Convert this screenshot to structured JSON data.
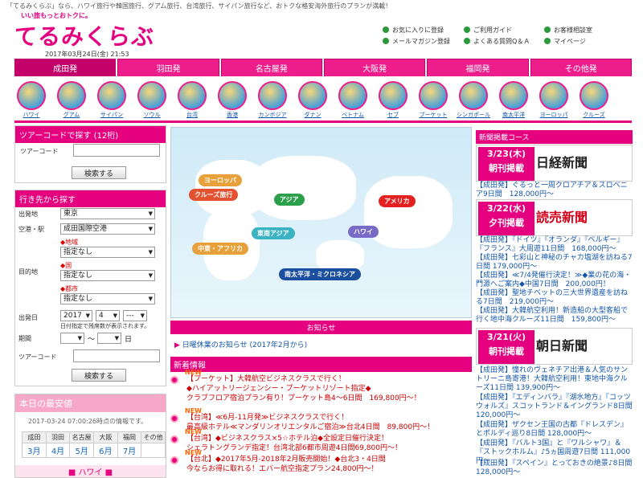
{
  "header": {
    "tagline": "「てるみくらぶ」なら、ハワイ旅行や韓国旅行、グアム旅行、台湾旅行、サイパン旅行など、おトクな格安海外旅行のプランが満載！",
    "logo_sub": "いい旅もっとおトクに。",
    "logo": "てるみくらぶ",
    "datetime": "2017年03月24日(金) 21:53",
    "links": [
      "お気に入りに登録",
      "ご利用ガイド",
      "お客様相談室",
      "メールマガジン登録",
      "よくある質問Q＆Ａ",
      "マイページ"
    ]
  },
  "nav": [
    "成田発",
    "羽田発",
    "名古屋発",
    "大阪発",
    "福岡発",
    "その他発"
  ],
  "destinations": [
    "ハワイ",
    "グアム",
    "サイパン",
    "ソウル",
    "台湾",
    "香港",
    "カンボジア",
    "ダナン",
    "ベトナム",
    "セブ",
    "プーケット",
    "シンガポール",
    "南太平洋",
    "ヨーロッパ",
    "クルーズ"
  ],
  "tourcode": {
    "head": "ツアーコードで探す (12桁)",
    "label": "ツアーコード",
    "button": "検索する"
  },
  "destsearch": {
    "head": "行き先から探す",
    "dep_label": "出発地",
    "dep_value": "東京",
    "airport_label": "空港・駅",
    "airport_value": "成田国際空港",
    "area_note": "◆地域",
    "area_value": "指定なし",
    "dest_label": "目的地",
    "country_note": "◆国",
    "country_value": "指定なし",
    "city_note": "◆都市",
    "city_value": "指定なし",
    "date_label": "出発日",
    "year": "2017",
    "month": "4",
    "day": "---",
    "date_note": "日付指定で残席数が表示されます。",
    "period_label": "期間",
    "period_sep": "〜",
    "period_unit": "日",
    "code_label": "ツアーコード",
    "button": "検索する"
  },
  "cheapest": {
    "head": "本日の最安値",
    "info": "2017-03-24 07:00:26時点の情報です。",
    "origins": [
      "成田",
      "羽田",
      "名古屋",
      "大阪",
      "福岡",
      "その他"
    ],
    "months": [
      "3月",
      "4月",
      "5月",
      "6月",
      "7月"
    ],
    "region": "■ ハワイ ■"
  },
  "map": {
    "labels": [
      "ヨーロッパ",
      "クルーズ旅行",
      "アジア",
      "アメリカ",
      "東南アジア",
      "ハワイ",
      "中東・アフリカ",
      "南太平洋・ミクロネシア"
    ]
  },
  "notice": {
    "head": "お知らせ",
    "item": "日曜休業のお知らせ (2017年2月から)"
  },
  "news": {
    "head": "新着情報",
    "badge": "NEW",
    "items": [
      [
        "【プーケット】大韓航空ビジネスクラスで行く！",
        "◆ハイアットリージェンシー・プーケットリゾート指定◆",
        "クラブフロア宿泊プラン有り！プーケット島4〜6日間　169,800円〜！"
      ],
      [
        "【台湾】≪6月-11月発≫ビジネスクラスで行く！",
        "最高級ホテル≪マンダリンオリエンタルご宿泊≫台北4日間　89,800円〜！"
      ],
      [
        "【台湾】◆ビジネスクラス×5☆ホテル泊◆全設定日催行決定！",
        "シェラトングランデ指定！台湾北部6都市周遊4日間69,800円〜！"
      ],
      [
        "【台北】◆2017年5月-2018年2月販売開始！◆台北3・4日間",
        "今ならお得に取れる！エバー航空指定プラン24,800円〜！"
      ]
    ]
  },
  "right": {
    "head": "新聞掲載コース",
    "papers": [
      {
        "date": "3/23(木)",
        "kind": "朝刊掲載",
        "name": "日経新聞",
        "color": "#1a7a2a"
      },
      {
        "date": "3/22(水)",
        "kind": "夕刊掲載",
        "name": "読売新聞",
        "color": "#d0001b"
      },
      {
        "date": "3/21(火)",
        "kind": "朝刊掲載",
        "name": "朝日新聞",
        "color": "#1a7a2a"
      }
    ],
    "texts": [
      "【成田発】ぐるっと一周クロアチア＆スロベニア9日間　128,000円〜",
      "【成田発】『ドイツ』『オランダ』『ベルギー』『フランス』大周遊11日間　168,000円〜",
      "【成田発】七彩山と神秘のチャカ塩湖を訪ねる7日間 179,000円〜",
      "【成田発】≪7/4発催行決定！≫◆業の花の海・門源へご案内◆中国7日間　200,000円！",
      "【成田発】聖地チベットの三大世界遺産を訪ねる7日間　219,000円〜",
      "【成田発】大韓航空利用！新造船の大型客船で行く地中海クルーズ11日間　159,800円〜",
      "【成田発】憧れのヴェネチア出港＆人気のサントリーニ島寄港！大韓航空利用！東地中海クルーズ11日間 139,900円〜",
      "【成田発】『エディンバラ』『湖水地方』『コッツウォルズ』スコットランド＆イングランド8日間 120,000円〜",
      "【成田発】ザクセン王国の古都『ドレスデン』とポルディ巡り8日間 128,000円〜",
      "【成田発】『バルト3国』と『ワルシャワ』＆『ストックホルム』♪5ヵ国周遊7日間 111,000円〜",
      "【成田発】『スペイン』とっておきの絶景♪8日間 128,000円〜"
    ]
  }
}
